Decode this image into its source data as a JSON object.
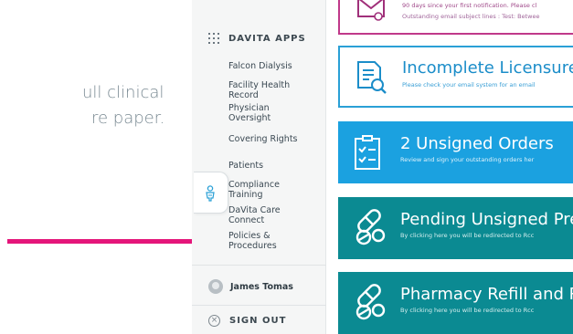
{
  "background": {
    "line1": "ull clinical",
    "line2": "re paper."
  },
  "colors": {
    "arrow": "#e4157a",
    "sidebar_bg": "#f5f6f6",
    "licensure_border": "#2aa0d6",
    "orders_bg": "#1ba1e0",
    "teal_bg": "#0b8a92",
    "notice_border": "#c0398a"
  },
  "sidebar": {
    "apps_title": "DAVITA APPS",
    "items": [
      {
        "label_lines": [
          "Falcon Dialysis"
        ]
      },
      {
        "label_lines": [
          "Facility Health",
          "Record"
        ]
      },
      {
        "label_lines": [
          "Physician",
          "Oversight"
        ]
      },
      {
        "label_lines": [
          "Covering Rights"
        ]
      },
      {
        "label_lines": [
          "Patients"
        ]
      },
      {
        "label_lines": [
          "Compliance",
          "Training"
        ]
      },
      {
        "label_lines": [
          "DaVita Care",
          "Connect"
        ]
      },
      {
        "label_lines": [
          "Policies &",
          "Procedures"
        ]
      }
    ],
    "user_name": "James Tomas",
    "signout_label": "SIGN OUT",
    "help_icon": "person-help-icon"
  },
  "cards": {
    "notice": {
      "line1": "90 days since your first notification. Please cl",
      "line2": "Outstanding email subject lines : Test: Betwee",
      "icon": "alert-envelope-icon"
    },
    "licensure": {
      "title": "Incomplete Licensure &",
      "subtitle": "Please check your email system for an email",
      "icon": "document-search-icon"
    },
    "orders": {
      "title": "2 Unsigned Orders",
      "subtitle": "Review and sign your outstanding orders her",
      "icon": "checklist-icon"
    },
    "prescriptions": {
      "title": "Pending Unsigned Pre",
      "subtitle": "By clicking here you will be redirected to Rcc",
      "icon": "pills-icon"
    },
    "refill": {
      "title": "Pharmacy Refill and Re",
      "subtitle": "By clicking here you will be redirected to Rcc",
      "icon": "pills-icon"
    }
  }
}
